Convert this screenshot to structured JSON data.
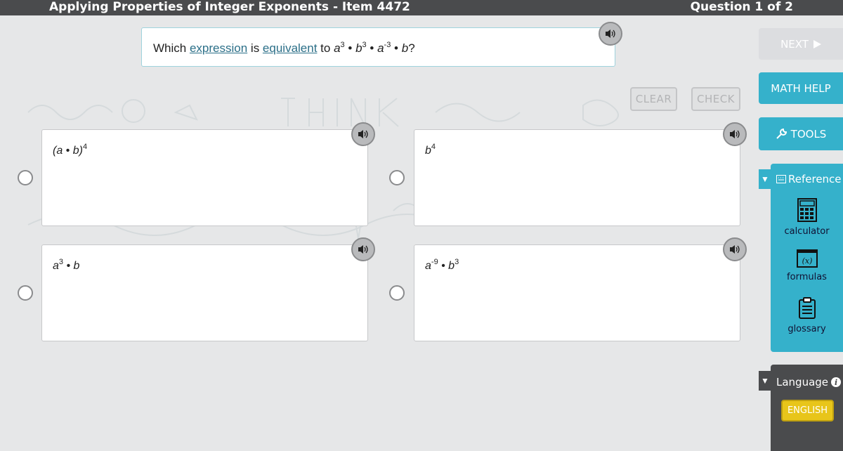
{
  "header": {
    "title": "Applying Properties of Integer Exponents - Item 4472",
    "question_count": "Question 1 of 2"
  },
  "question": {
    "prefix": "Which ",
    "link1": "expression",
    "mid": " is ",
    "link2": "equivalent",
    "to": " to ",
    "expr": {
      "a1": "a",
      "a1_exp": "3",
      "dot1": " • ",
      "b1": "b",
      "b1_exp": "3",
      "dot2": " • ",
      "a2": "a",
      "a2_exp": "-3",
      "dot3": " • ",
      "b2": "b",
      "end": "?"
    }
  },
  "controls": {
    "clear_label": "CLEAR",
    "check_label": "CHECK"
  },
  "answers": [
    {
      "base": "(a • b)",
      "exp": "4",
      "tail": ""
    },
    {
      "base": "b",
      "exp": "4",
      "tail": ""
    },
    {
      "base": "a",
      "exp": "3",
      "tail": " • b"
    },
    {
      "base": "a",
      "exp": "-9",
      "tail": " • b",
      "tail_exp": "3"
    }
  ],
  "sidebar": {
    "next_label": "NEXT",
    "math_help_label": "MATH HELP",
    "tools_label": "TOOLS",
    "reference_label": "Reference",
    "reference_items": [
      {
        "label": "calculator",
        "icon": "calculator-icon"
      },
      {
        "label": "formulas",
        "icon": "formulas-icon"
      },
      {
        "label": "glossary",
        "icon": "glossary-icon"
      }
    ],
    "language_label": "Language",
    "language_button": "ENGLISH"
  },
  "colors": {
    "accent": "#35b1cb",
    "topbar": "#4a4b4d",
    "language_button": "#e8c51a",
    "link": "#2b6f88"
  }
}
